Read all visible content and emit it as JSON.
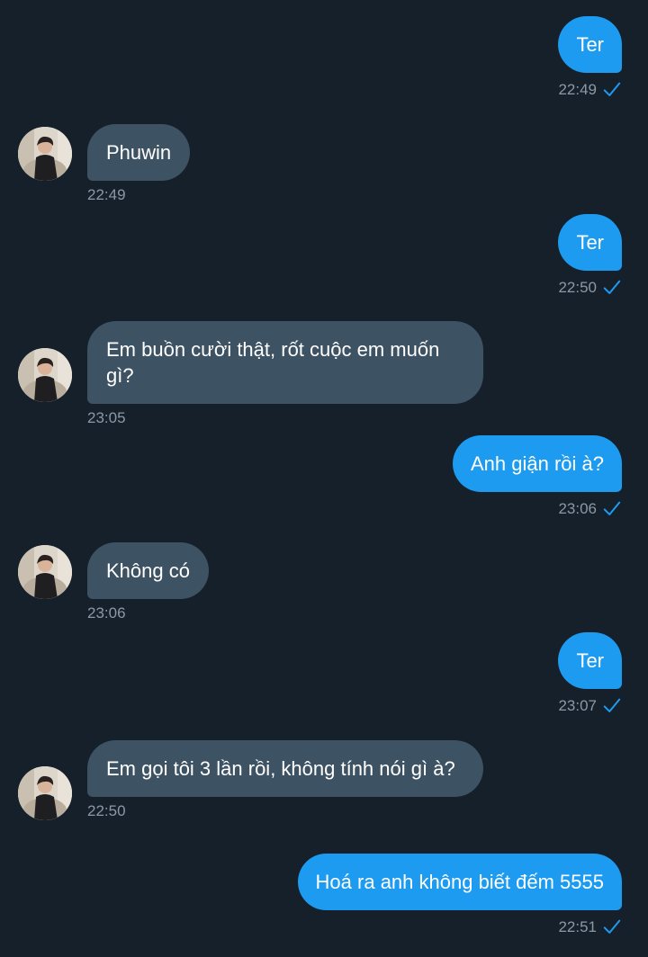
{
  "colors": {
    "background": "#15202b",
    "outgoing_bubble": "#1d9bf0",
    "incoming_bubble": "#3d5263",
    "timestamp": "#8b98a5",
    "read_check": "#1d9bf0"
  },
  "messages": [
    {
      "direction": "out",
      "text": "Ter",
      "time": "22:49",
      "status_icon": "read-check-icon"
    },
    {
      "direction": "in",
      "text": "Phuwin",
      "time": "22:49",
      "avatar_icon": "contact-avatar"
    },
    {
      "direction": "out",
      "text": "Ter",
      "time": "22:50",
      "status_icon": "read-check-icon"
    },
    {
      "direction": "in",
      "text": "Em buồn cười thật, rốt cuộc em muốn gì?",
      "time": "23:05",
      "avatar_icon": "contact-avatar"
    },
    {
      "direction": "out",
      "text": "Anh giận rồi à?",
      "time": "23:06",
      "status_icon": "read-check-icon"
    },
    {
      "direction": "in",
      "text": "Không có",
      "time": "23:06",
      "avatar_icon": "contact-avatar"
    },
    {
      "direction": "out",
      "text": "Ter",
      "time": "23:07",
      "status_icon": "read-check-icon"
    },
    {
      "direction": "in",
      "text": "Em gọi tôi 3 lần rồi, không tính nói gì à?",
      "time": "22:50",
      "avatar_icon": "contact-avatar"
    },
    {
      "direction": "out",
      "text": "Hoá ra anh không biết đếm 5555",
      "time": "22:51",
      "status_icon": "read-check-icon"
    }
  ]
}
